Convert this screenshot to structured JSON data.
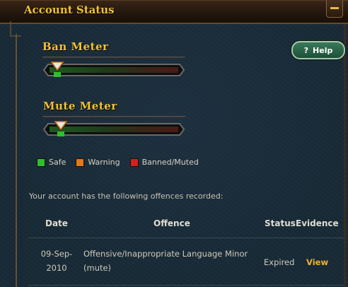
{
  "window": {
    "title": "Account Status"
  },
  "help": {
    "label": "Help",
    "glyph": "?"
  },
  "meters": {
    "ban": {
      "label": "Ban Meter",
      "level_fraction": 0.06
    },
    "mute": {
      "label": "Mute Meter",
      "level_fraction": 0.09
    }
  },
  "legend": [
    {
      "label": "Safe",
      "color": "#2fbf2f"
    },
    {
      "label": "Warning",
      "color": "#e07a1a"
    },
    {
      "label": "Banned/Muted",
      "color": "#d42020"
    }
  ],
  "offences": {
    "intro": "Your account has the following offences recorded:",
    "columns": {
      "date": "Date",
      "offence": "Offence",
      "status": "Status",
      "evidence": "Evidence"
    },
    "rows": [
      {
        "date_line1": "09-Sep-",
        "date_line2": "2010",
        "offence_line1": "Offensive/Inappropriate Language Minor",
        "offence_line2": "(mute)",
        "status": "Expired",
        "evidence": "View"
      }
    ]
  },
  "colors": {
    "accent_gold": "#f1c233",
    "link": "#f1b32e"
  }
}
